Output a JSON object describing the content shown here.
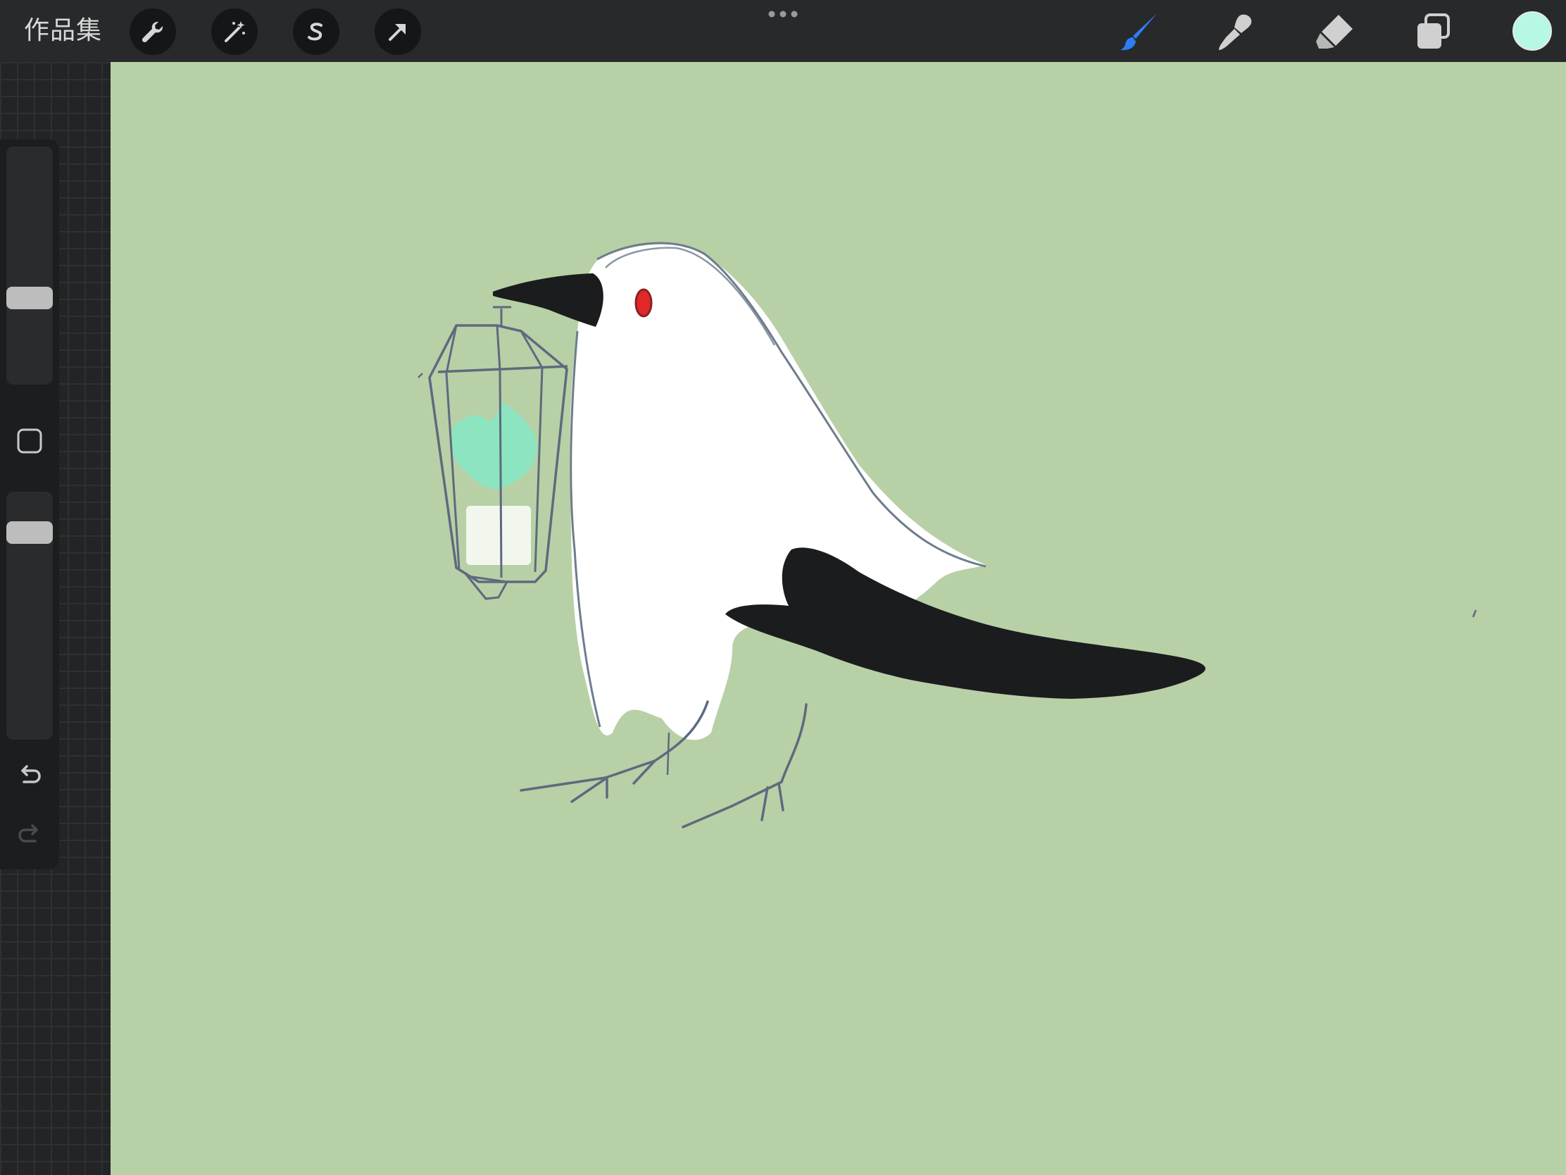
{
  "toolbar": {
    "gallery_label": "作品集",
    "left_tools": [
      {
        "name": "actions",
        "icon": "wrench-icon"
      },
      {
        "name": "adjustments",
        "icon": "magic-wand-icon"
      },
      {
        "name": "selection",
        "icon": "selection-s-icon"
      },
      {
        "name": "transform",
        "icon": "arrow-cursor-icon"
      }
    ],
    "more_icon": "more-dots-icon",
    "right_tools": [
      {
        "name": "brush",
        "icon": "brush-icon",
        "active": true
      },
      {
        "name": "smudge",
        "icon": "smudge-icon"
      },
      {
        "name": "eraser",
        "icon": "eraser-icon"
      },
      {
        "name": "layers",
        "icon": "layers-icon"
      }
    ],
    "current_color": "#b6f7e5",
    "active_tool_color": "#2f7cf6"
  },
  "sidebar": {
    "brush_size_level": 0.35,
    "opacity_level": 0.87,
    "modify_icon": "square-icon",
    "undo_icon": "undo-icon",
    "redo_icon": "redo-icon"
  },
  "canvas": {
    "background": "#b8d0a6",
    "illustration": "ghost-crow-with-lantern"
  }
}
